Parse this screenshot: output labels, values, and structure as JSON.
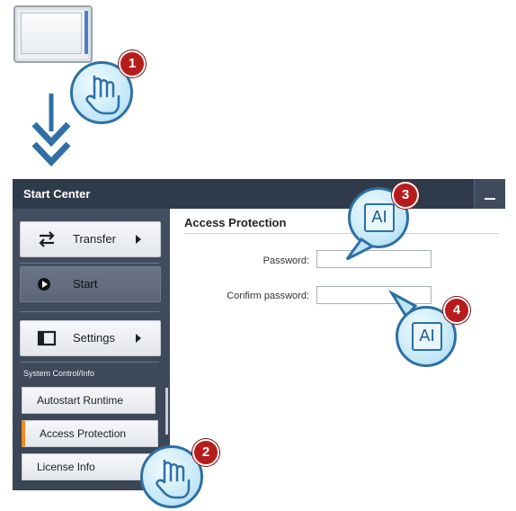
{
  "window": {
    "title": "Start Center"
  },
  "sidebar": {
    "items": [
      {
        "label": "Transfer",
        "icon": "transfer-arrows-icon"
      },
      {
        "label": "Start",
        "icon": "play-icon"
      },
      {
        "label": "Settings",
        "icon": "settings-window-icon"
      }
    ],
    "section_label": "System Control/Info",
    "sub_items": [
      {
        "label": "Autostart Runtime"
      },
      {
        "label": "Access Protection"
      },
      {
        "label": "License Info"
      }
    ]
  },
  "content": {
    "title": "Access Protection",
    "password_label": "Password:",
    "confirm_label": "Confirm password:",
    "password_value": "",
    "confirm_value": ""
  },
  "callouts": {
    "step1": "1",
    "step2": "2",
    "step3": "3",
    "step4": "4",
    "keyboard_glyph": "AI"
  },
  "colors": {
    "titlebar": "#2f3a4a",
    "sidebar": "#3d4859",
    "active_accent": "#f28a1c",
    "arrow": "#2f6fa5",
    "badge": "#b71c1c"
  }
}
